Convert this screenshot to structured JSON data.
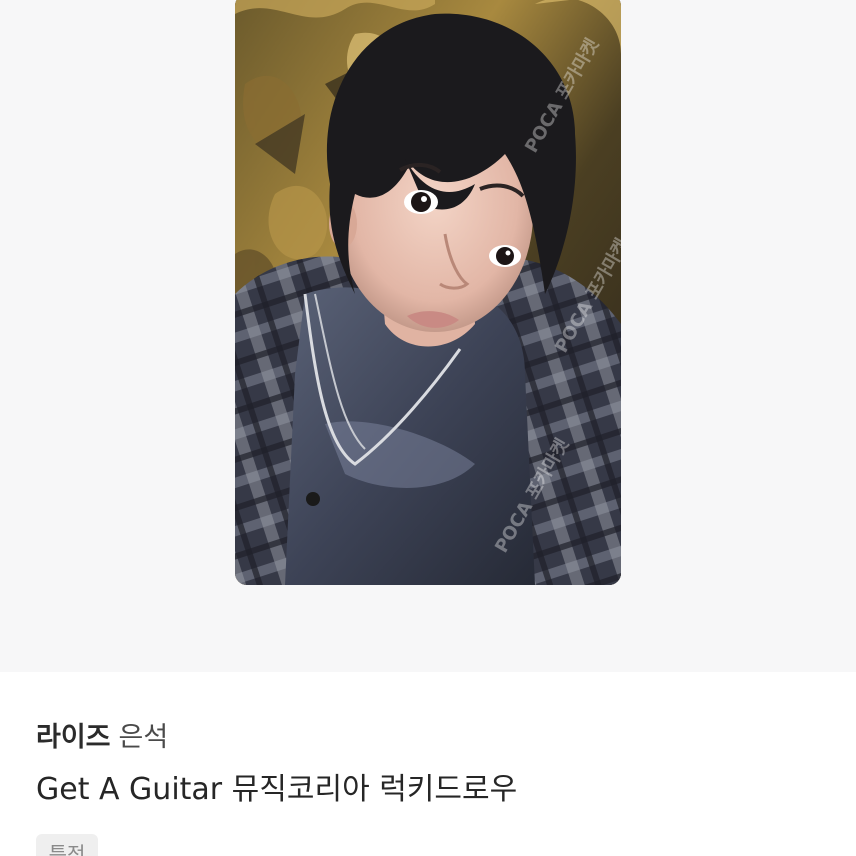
{
  "photo": {
    "watermark_text": "POCA 포카마켓"
  },
  "item": {
    "artist": "라이즈",
    "member": "은석",
    "title": "Get A Guitar 뮤직코리아 럭키드로우",
    "tag": "특전"
  }
}
